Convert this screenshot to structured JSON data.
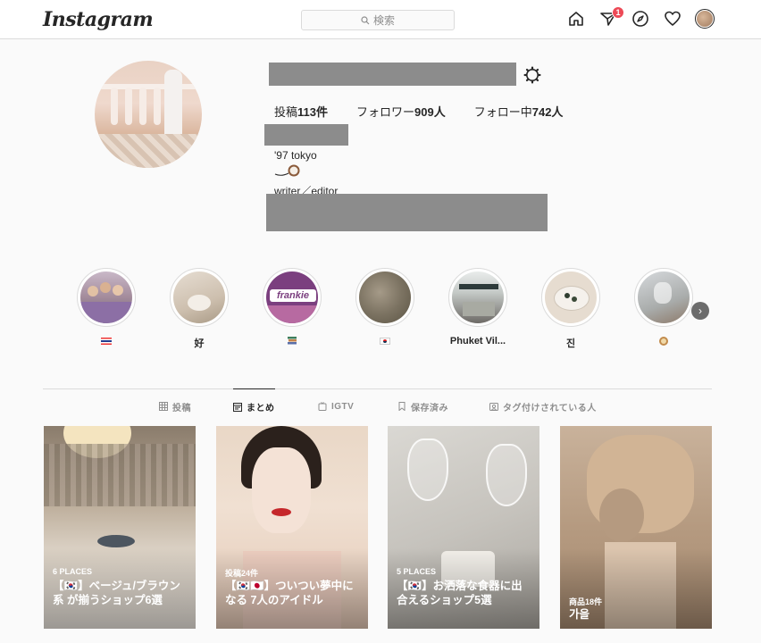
{
  "header": {
    "logo": "Instagram",
    "search_placeholder": "検索",
    "notification_count": "1"
  },
  "profile": {
    "stats": [
      {
        "label": "投稿",
        "value": "113件"
      },
      {
        "label": "フォロワー",
        "value": "909人"
      },
      {
        "label": "フォロー中",
        "value": "742人"
      }
    ],
    "bio_lines": [
      "'97 tokyo",
      "writer／editor"
    ]
  },
  "highlights": [
    {
      "label": "🇹🇭",
      "flag": "th"
    },
    {
      "label": "好"
    },
    {
      "label": "📚"
    },
    {
      "label": "🇰🇷",
      "flag": "kr"
    },
    {
      "label": "Phuket Vil..."
    },
    {
      "label": "진"
    },
    {
      "label": "🥥"
    }
  ],
  "tabs": [
    {
      "label": "投稿",
      "icon": "grid-icon"
    },
    {
      "label": "まとめ",
      "icon": "guide-icon",
      "active": true
    },
    {
      "label": "IGTV",
      "icon": "igtv-icon"
    },
    {
      "label": "保存済み",
      "icon": "bookmark-icon"
    },
    {
      "label": "タグ付けされている人",
      "icon": "tag-person-icon"
    }
  ],
  "guides": [
    {
      "meta": "6 PLACES",
      "title": "【🇰🇷】ベージュ/ブラウン系 が揃うショップ6選"
    },
    {
      "meta": "投稿24件",
      "title": "【🇰🇷🇯🇵】ついつい夢中になる 7人のアイドル"
    },
    {
      "meta": "5 PLACES",
      "title": "【🇰🇷】お洒落な食器に出合えるショップ5選"
    },
    {
      "meta": "商品18件",
      "title": "가을"
    }
  ],
  "colors": {
    "accent_badge": "#ed4956",
    "border": "#dbdbdb",
    "text": "#262626",
    "muted": "#8e8e8e",
    "redaction": "#8c8c8c"
  }
}
